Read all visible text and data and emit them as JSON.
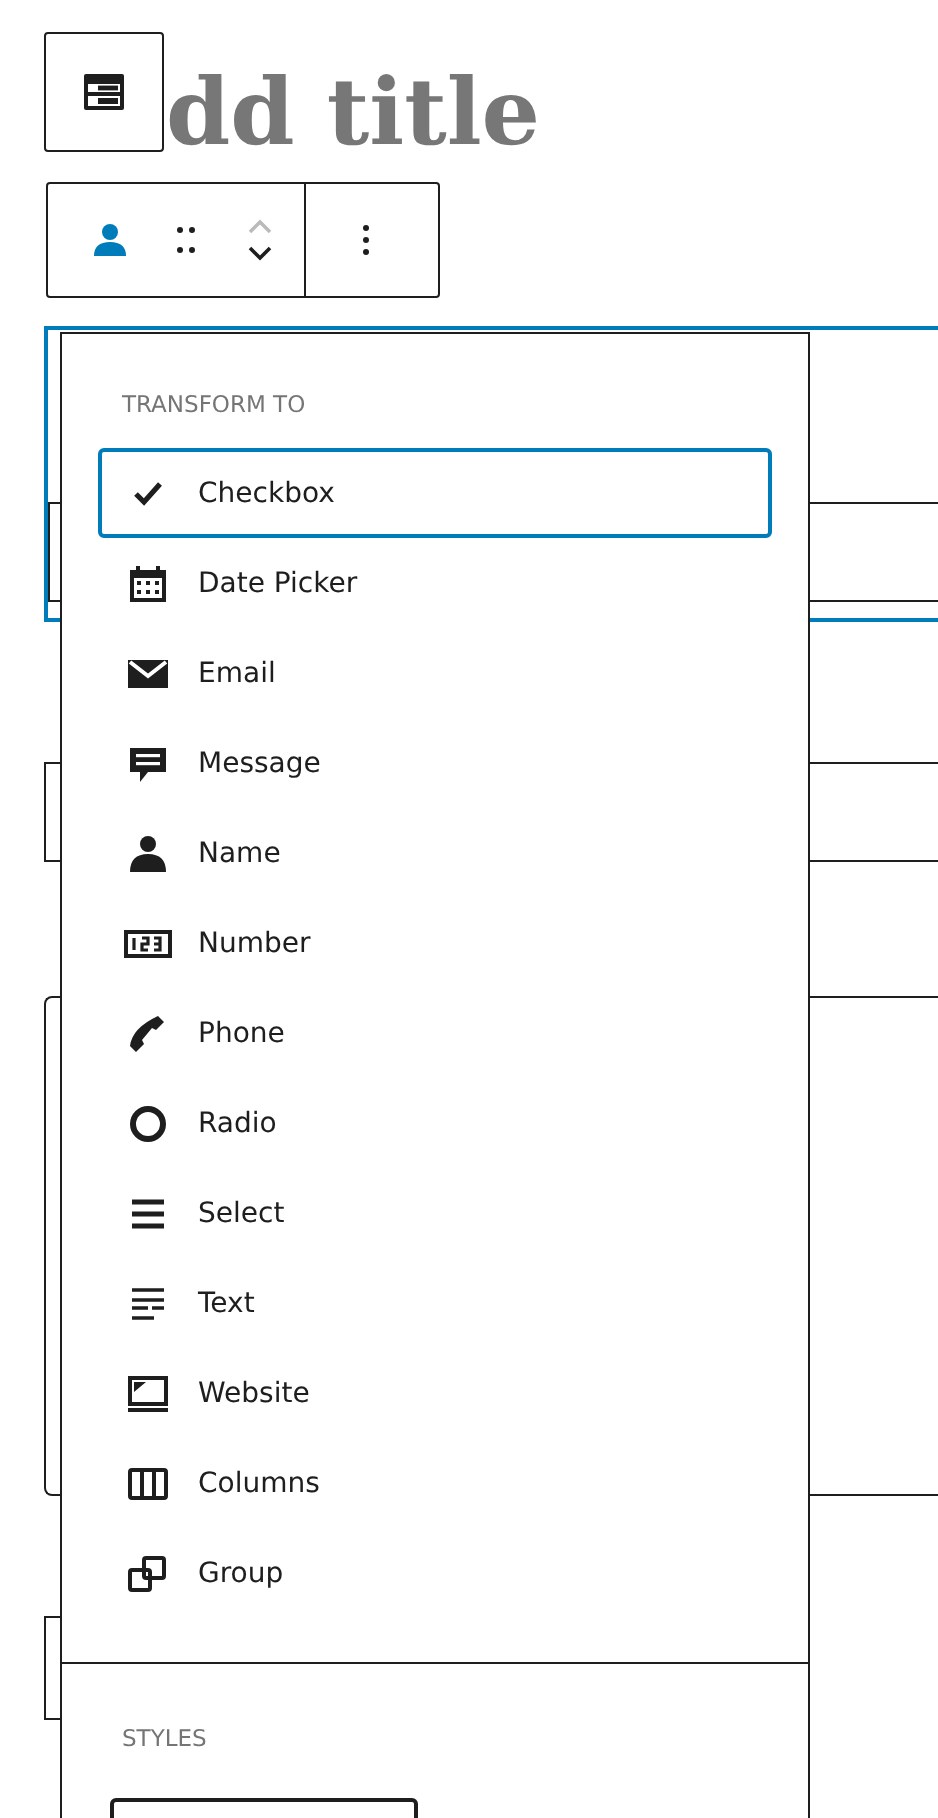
{
  "title": {
    "placeholder": "dd title"
  },
  "transform_menu": {
    "heading": "TRANSFORM TO",
    "items": [
      {
        "label": "Checkbox",
        "selected": true
      },
      {
        "label": "Date Picker",
        "selected": false
      },
      {
        "label": "Email",
        "selected": false
      },
      {
        "label": "Message",
        "selected": false
      },
      {
        "label": "Name",
        "selected": false
      },
      {
        "label": "Number",
        "selected": false
      },
      {
        "label": "Phone",
        "selected": false
      },
      {
        "label": "Radio",
        "selected": false
      },
      {
        "label": "Select",
        "selected": false
      },
      {
        "label": "Text",
        "selected": false
      },
      {
        "label": "Website",
        "selected": false
      },
      {
        "label": "Columns",
        "selected": false
      },
      {
        "label": "Group",
        "selected": false
      }
    ],
    "styles_heading": "STYLES"
  }
}
